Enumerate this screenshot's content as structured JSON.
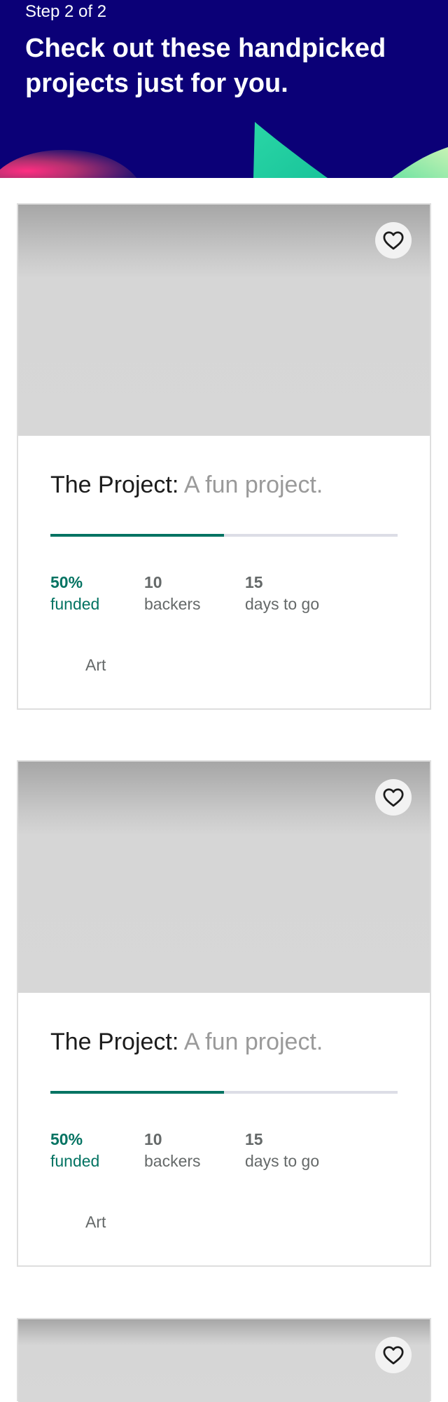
{
  "header": {
    "step_label": "Step 2 of 2",
    "title": "Check out these handpicked projects just for you.",
    "background_color": "#0b0077"
  },
  "projects": [
    {
      "name": "The Project:",
      "blurb": "A fun project.",
      "percent_funded": "50%",
      "percent_funded_value": 50,
      "funded_label": "funded",
      "backers_count": "10",
      "backers_label": "backers",
      "days_count": "15",
      "days_label": "days to go",
      "category": "Art",
      "save_icon": "heart-outline-icon"
    },
    {
      "name": "The Project:",
      "blurb": "A fun project.",
      "percent_funded": "50%",
      "percent_funded_value": 50,
      "funded_label": "funded",
      "backers_count": "10",
      "backers_label": "backers",
      "days_count": "15",
      "days_label": "days to go",
      "category": "Art",
      "save_icon": "heart-outline-icon"
    },
    {
      "save_icon": "heart-outline-icon"
    }
  ],
  "colors": {
    "accent_green": "#037362",
    "progress_track": "#dcdde6",
    "text_primary": "#1c1c1c",
    "text_secondary": "#656969",
    "blurb_gray": "#9a9a9a"
  }
}
